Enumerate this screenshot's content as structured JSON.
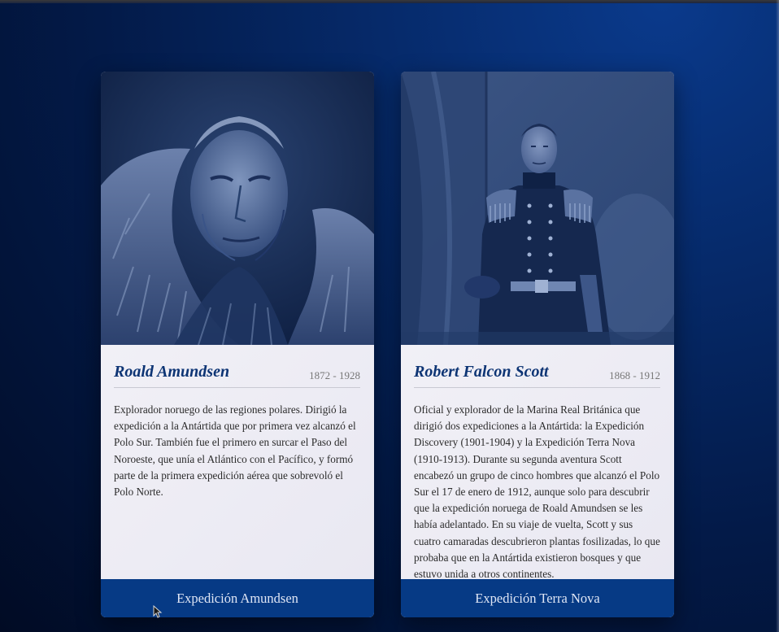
{
  "explorers": [
    {
      "name": "Roald Amundsen",
      "dates": "1872 - 1928",
      "description": "Explorador noruego de las regiones polares. Dirigió la expedición a la Antártida que por primera vez alcanzó el Polo Sur. También fue el primero en surcar el Paso del Noroeste, que unía el Atlántico con el Pacífico, y formó parte de la primera expedición aérea que sobrevoló el Polo Norte.",
      "button_label": "Expedición Amundsen",
      "photo_subject": "portrait-in-fur-hood"
    },
    {
      "name": "Robert Falcon Scott",
      "dates": "1868 - 1912",
      "description": "Oficial y explorador de la Marina Real Británica que dirigió dos expediciones a la Antártida: la Expedición Discovery (1901-1904) y la Expedición Terra Nova (1910-1913). Durante su segunda aventura Scott encabezó un grupo de cinco hombres que alcanzó el Polo Sur el 17 de enero de 1912, aunque solo para descubrir que la expedición noruega de Roald Amundsen se les había adelantado. En su viaje de vuelta, Scott y sus cuatro camaradas descubrieron plantas fosilizadas, lo que probaba que en la Antártida existieron bosques y que estuvo unida a otros continentes.",
      "button_label": "Expedición Terra Nova",
      "photo_subject": "portrait-in-naval-uniform"
    }
  ],
  "colors": {
    "background": "#031a48",
    "card_body": "#ecebf3",
    "name_text": "#0d3474",
    "button_bg": "#063a85",
    "button_text": "#dfe6f5"
  }
}
